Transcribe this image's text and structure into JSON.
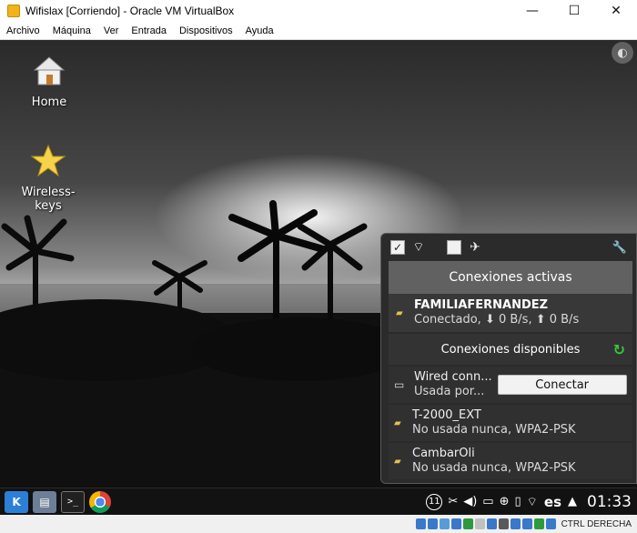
{
  "window": {
    "title": "Wifislax [Corriendo] - Oracle VM VirtualBox",
    "minimize_glyph": "—",
    "maximize_glyph": "☐",
    "close_glyph": "✕"
  },
  "menubar": {
    "items": [
      "Archivo",
      "Máquina",
      "Ver",
      "Entrada",
      "Dispositivos",
      "Ayuda"
    ]
  },
  "desktop": {
    "icons": [
      {
        "label": "Home",
        "icon": "home-folder-icon"
      },
      {
        "label": "Wireless-\nkeys",
        "icon": "star-icon"
      }
    ]
  },
  "network_popup": {
    "active_header": "Conexiones activas",
    "active_connection": {
      "name": "FAMILIAFERNANDEZ",
      "status": "Conectado, ⬇ 0 B/s, ⬆ 0 B/s"
    },
    "available_header": "Conexiones disponibles",
    "wired": {
      "name": "Wired conn...",
      "status": "Usada por...",
      "button": "Conectar"
    },
    "networks": [
      {
        "name": "T-2000_EXT",
        "status": "No usada nunca,  WPA2-PSK"
      },
      {
        "name": "CambarOli",
        "status": "No usada nunca,  WPA2-PSK"
      }
    ]
  },
  "panel": {
    "kde_label": "K",
    "badge": "11",
    "language": "es",
    "clock": "01:33"
  },
  "statusbar": {
    "host_key": "CTRL DERECHA",
    "icon_colors": [
      "#3a78c9",
      "#3a78c9",
      "#5a9bd6",
      "#3a78c9",
      "#2e9a3f",
      "#c0c0c0",
      "#3a78c9",
      "#5a5a5a",
      "#3a78c9",
      "#3a78c9",
      "#2e9a3f",
      "#3a78c9"
    ]
  }
}
